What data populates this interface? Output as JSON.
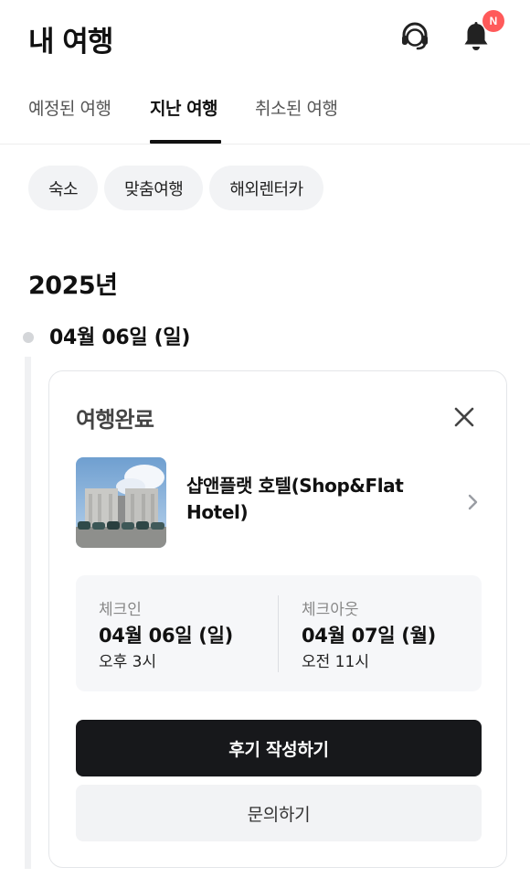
{
  "header": {
    "title": "내 여행",
    "support_icon": "headset-icon",
    "bell_icon": "bell-icon",
    "notification_badge": "N"
  },
  "tabs": [
    {
      "label": "예정된 여행",
      "active": false
    },
    {
      "label": "지난 여행",
      "active": true
    },
    {
      "label": "취소된 여행",
      "active": false
    }
  ],
  "filters": [
    "숙소",
    "맞춤여행",
    "해외렌터카"
  ],
  "timeline": {
    "year": "2025년",
    "date": "04월 06일 (일)"
  },
  "trip_card": {
    "status": "여행완료",
    "close_icon": "close-icon",
    "hotel_name": "샵앤플랫 호텔(Shop&Flat Hotel)",
    "chevron_icon": "chevron-right-icon",
    "checkin": {
      "label": "체크인",
      "date": "04월 06일 (일)",
      "time": "오후 3시"
    },
    "checkout": {
      "label": "체크아웃",
      "date": "04월 07일 (월)",
      "time": "오전 11시"
    },
    "review_button": "후기 작성하기",
    "inquiry_button": "문의하기"
  },
  "colors": {
    "primary_button": "#17181b",
    "badge": "#ff5a5a",
    "chip_bg": "#f2f3f5"
  }
}
